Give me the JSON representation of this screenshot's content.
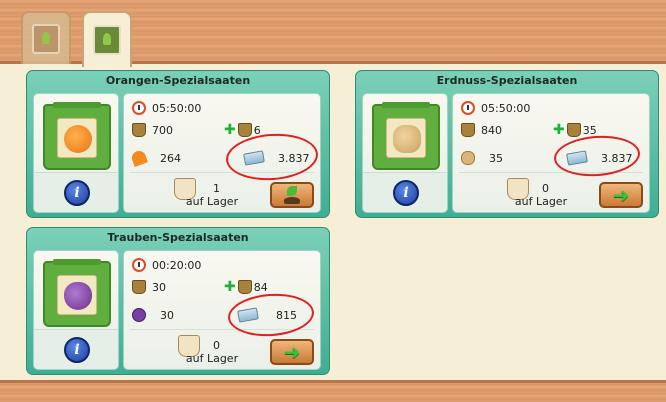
{
  "tabs": [
    {
      "name": "seed-tab-inactive",
      "icon": "seed-packet-icon"
    },
    {
      "name": "seed-tab-active",
      "icon": "sprout-packet-icon"
    }
  ],
  "cards": [
    {
      "title": "Orangen-Spezialsaaten",
      "fruit_icon": "orange-icon",
      "time": "05:50:00",
      "basket": "700",
      "bonus": "6",
      "fruit_amount": "264",
      "price": "3.837",
      "stock_count": "1",
      "stock_label": "auf Lager",
      "action": "plant-button"
    },
    {
      "title": "Erdnuss-Spezialsaaten",
      "fruit_icon": "peanut-icon",
      "time": "05:50:00",
      "basket": "840",
      "bonus": "35",
      "fruit_amount": "35",
      "price": "3.837",
      "stock_count": "0",
      "stock_label": "auf Lager",
      "action": "buy-arrow-button"
    },
    {
      "title": "Trauben-Spezialsaaten",
      "fruit_icon": "grape-icon",
      "time": "00:20:00",
      "basket": "30",
      "bonus": "84",
      "fruit_amount": "30",
      "price": "815",
      "stock_count": "0",
      "stock_label": "auf Lager",
      "action": "buy-arrow-button"
    }
  ],
  "colors": {
    "card_bg": "#3fae94",
    "annotation": "#e02020",
    "wood": "#d9956a"
  }
}
